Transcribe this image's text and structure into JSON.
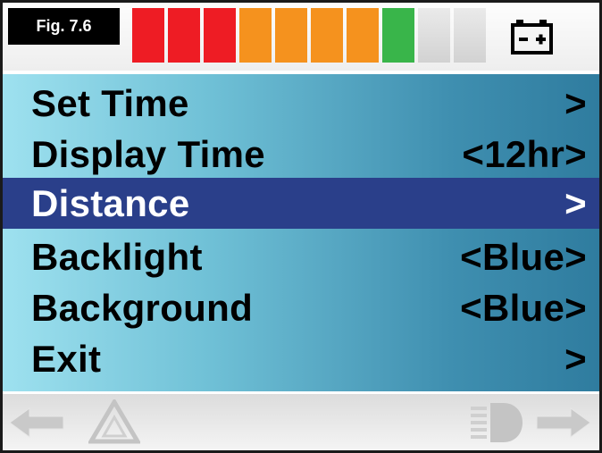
{
  "figure_label": "Fig. 7.6",
  "battery_gauge": {
    "segments": [
      {
        "color": "#ee1c24",
        "state": "lit"
      },
      {
        "color": "#ee1c24",
        "state": "lit"
      },
      {
        "color": "#ee1c24",
        "state": "lit"
      },
      {
        "color": "#f5921e",
        "state": "lit"
      },
      {
        "color": "#f5921e",
        "state": "lit"
      },
      {
        "color": "#f5921e",
        "state": "lit"
      },
      {
        "color": "#f5921e",
        "state": "lit"
      },
      {
        "color": "#39b54a",
        "state": "lit"
      },
      {
        "color": "#dcdcdc",
        "state": "unlit"
      },
      {
        "color": "#dcdcdc",
        "state": "unlit"
      }
    ],
    "icon": "battery-icon"
  },
  "menu": {
    "items": [
      {
        "label": "Set Time",
        "value": ">",
        "selected": false
      },
      {
        "label": "Display Time",
        "value": "<12hr>",
        "selected": false
      },
      {
        "label": "Distance",
        "value": ">",
        "selected": true
      },
      {
        "label": "Backlight",
        "value": "<Blue>",
        "selected": false
      },
      {
        "label": "Background",
        "value": "<Blue>",
        "selected": false
      },
      {
        "label": "Exit",
        "value": ">",
        "selected": false
      }
    ]
  },
  "bottom_bar": {
    "icons": [
      "left-arrow-icon",
      "hazard-warning-icon",
      "headlight-icon",
      "right-arrow-icon"
    ]
  },
  "colors": {
    "selected_row": "#2a3f8a",
    "panel_gradient_start": "#9ee1ef",
    "panel_gradient_end": "#2f7c9f"
  }
}
